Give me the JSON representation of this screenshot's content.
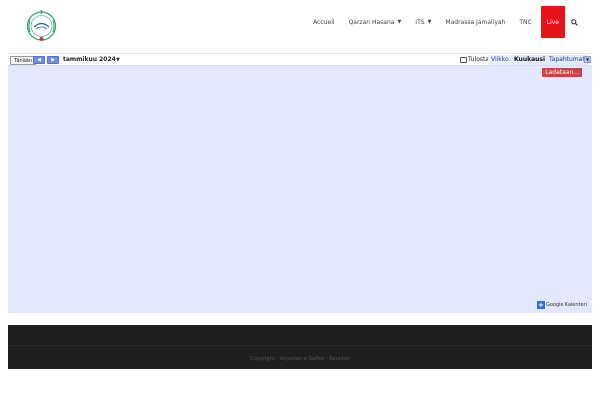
{
  "header": {
    "logo_icon": "mosque-emblem-icon",
    "nav": [
      {
        "label": "Accueil",
        "has_dropdown": false
      },
      {
        "label": "Qarzan Hasana",
        "has_dropdown": true
      },
      {
        "label": "ITS",
        "has_dropdown": true
      },
      {
        "label": "Madrassa Jamaliyah",
        "has_dropdown": false
      },
      {
        "label": "TNC",
        "has_dropdown": false
      },
      {
        "label": "Live",
        "has_dropdown": false
      }
    ],
    "search_icon": "search-icon",
    "live_color": "#e8121a"
  },
  "calendar": {
    "today_label": "Tänään",
    "prev_icon": "chevron-left-icon",
    "next_icon": "chevron-right-icon",
    "current_period": "tammikuu 2024",
    "print_label": "Tulosta",
    "tabs": [
      {
        "label": "Viikko",
        "active": false
      },
      {
        "label": "Kuukausi",
        "active": true
      },
      {
        "label": "Tapahtumat",
        "active": false
      }
    ],
    "loading_label": "Ladataan...",
    "badge": {
      "google": "Google",
      "product": "Kalenteri"
    },
    "body_color": "#e4e8fc"
  },
  "footer": {
    "copyright": "Copyright - Anjuman-e-Saifee - Réunion"
  }
}
